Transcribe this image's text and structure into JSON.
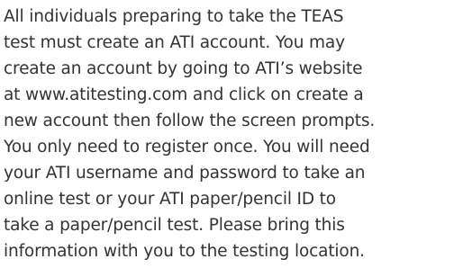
{
  "paragraph": {
    "lines": [
      "All individuals preparing to take the TEAS",
      "test must create an ATI account. You may",
      "create an account by going to ATI’s website",
      "at www.atitesting.com and click on create a",
      "new account then follow the screen prompts.",
      "You only need to register once. You will need",
      "your ATI username and password to take an",
      "online test or your ATI paper/pencil ID to",
      "take a paper/pencil test. Please bring this",
      "information with you to the testing location."
    ]
  }
}
